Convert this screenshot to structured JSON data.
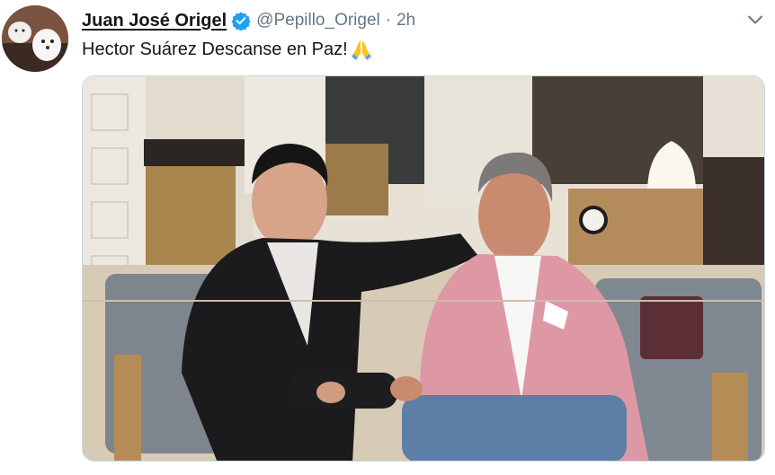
{
  "tweet": {
    "display_name": "Juan José Origel",
    "handle": "@Pepillo_Origel",
    "separator": "·",
    "time": "2h",
    "text": "Hector Suárez Descanse en Paz!",
    "emoji": "folded-hands-emoji",
    "verified_icon": "verified-badge-icon",
    "menu_icon": "chevron-down-icon"
  },
  "media": {
    "image": "photo-two-men-seated"
  },
  "colors": {
    "name": "#14171a",
    "secondary": "#657786",
    "verified": "#1da1f2",
    "border": "#ccd6dd"
  }
}
